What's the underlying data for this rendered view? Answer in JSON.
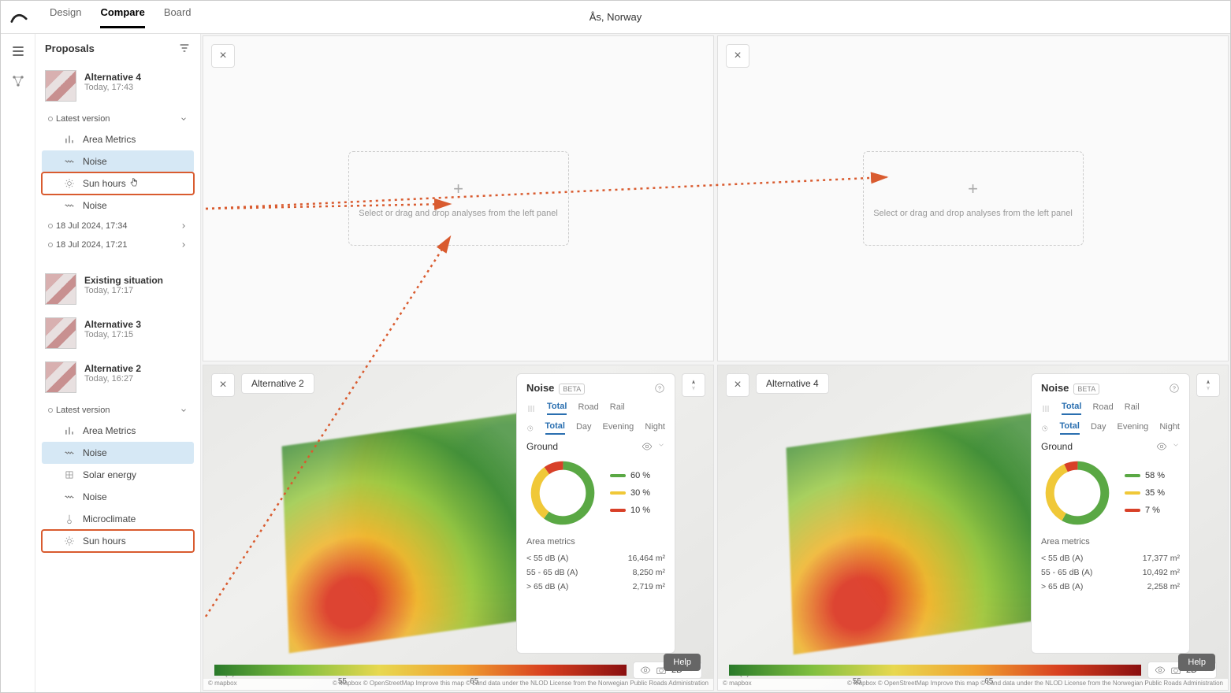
{
  "header": {
    "location": "Ås, Norway",
    "tabs": [
      "Design",
      "Compare",
      "Board"
    ],
    "active_tab": "Compare"
  },
  "sidebar": {
    "title": "Proposals",
    "proposals": [
      {
        "name": "Alternative 4",
        "time": "Today, 17:43"
      },
      {
        "name": "Existing situation",
        "time": "Today, 17:17"
      },
      {
        "name": "Alternative 3",
        "time": "Today, 17:15"
      },
      {
        "name": "Alternative 2",
        "time": "Today, 16:27"
      }
    ],
    "version_label": "Latest version",
    "analyses_a": [
      "Area Metrics",
      "Noise",
      "Sun hours",
      "Noise"
    ],
    "older_versions": [
      "18 Jul 2024, 17:34",
      "18 Jul 2024, 17:21"
    ],
    "analyses_b": [
      "Area Metrics",
      "Noise",
      "Solar energy",
      "Noise",
      "Microclimate",
      "Sun hours"
    ]
  },
  "dropzone_text": "Select or drag and drop analyses from the left panel",
  "panels": {
    "left": {
      "name": "Alternative 2"
    },
    "right": {
      "name": "Alternative 4"
    }
  },
  "noise_card": {
    "title": "Noise",
    "badge": "BETA",
    "mode_tabs": [
      "Total",
      "Road",
      "Rail"
    ],
    "time_tabs": [
      "Total",
      "Day",
      "Evening",
      "Night"
    ],
    "section": "Ground",
    "metrics_title": "Area metrics",
    "rows_labels": [
      "< 55 dB (A)",
      "55 - 65 dB (A)",
      "> 65 dB (A)"
    ],
    "left_pct": [
      "60 %",
      "30 %",
      "10 %"
    ],
    "left_areas": [
      "16,464 m²",
      "8,250 m²",
      "2,719 m²"
    ],
    "right_pct": [
      "58 %",
      "35 %",
      "7 %"
    ],
    "right_areas": [
      "17,377 m²",
      "10,492 m²",
      "2,258 m²"
    ]
  },
  "legend": {
    "unit": "dB (A)",
    "ticks": [
      "55",
      "65"
    ],
    "mode": "2D"
  },
  "colors": {
    "green": "#5aa844",
    "yellow": "#f0c838",
    "red": "#d84028",
    "highlight": "#d95b2f",
    "sel": "#d6e8f5"
  },
  "chart_data": [
    {
      "type": "pie",
      "title": "Noise — Alternative 2 — Ground",
      "categories": [
        "< 55 dB (A)",
        "55 - 65 dB (A)",
        "> 65 dB (A)"
      ],
      "values": [
        60,
        30,
        10
      ],
      "colors": [
        "#5aa844",
        "#f0c838",
        "#d84028"
      ]
    },
    {
      "type": "pie",
      "title": "Noise — Alternative 4 — Ground",
      "categories": [
        "< 55 dB (A)",
        "55 - 65 dB (A)",
        "> 65 dB (A)"
      ],
      "values": [
        58,
        35,
        7
      ],
      "colors": [
        "#5aa844",
        "#f0c838",
        "#d84028"
      ]
    }
  ],
  "help_label": "Help",
  "attrib": {
    "left": "© mapbox",
    "right": "© Mapbox   © OpenStreetMap   Improve this map   © Land data under the NLOD License from the Norwegian Public Roads Administration"
  }
}
